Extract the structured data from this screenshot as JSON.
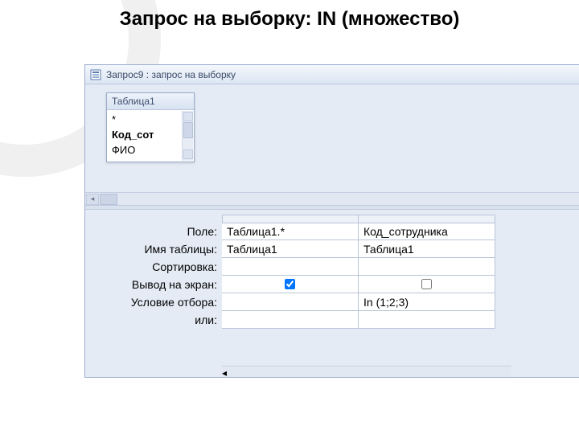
{
  "title": "Запрос на выборку: IN (множество)",
  "window": {
    "title": "Запрос9 : запрос на выборку"
  },
  "table_box": {
    "header": "Таблица1",
    "fields": [
      "*",
      "Код_сот",
      "ФИО"
    ]
  },
  "grid": {
    "labels": {
      "field": "Поле:",
      "table": "Имя таблицы:",
      "sort": "Сортировка:",
      "show": "Вывод на экран:",
      "criteria": "Условие отбора:",
      "or": "или:"
    },
    "columns": [
      {
        "field": "Таблица1.*",
        "table": "Таблица1",
        "sort": "",
        "show": true,
        "criteria": "",
        "or": ""
      },
      {
        "field": "Код_сотрудника",
        "table": "Таблица1",
        "sort": "",
        "show": false,
        "criteria": "In (1;2;3)",
        "or": ""
      }
    ]
  }
}
